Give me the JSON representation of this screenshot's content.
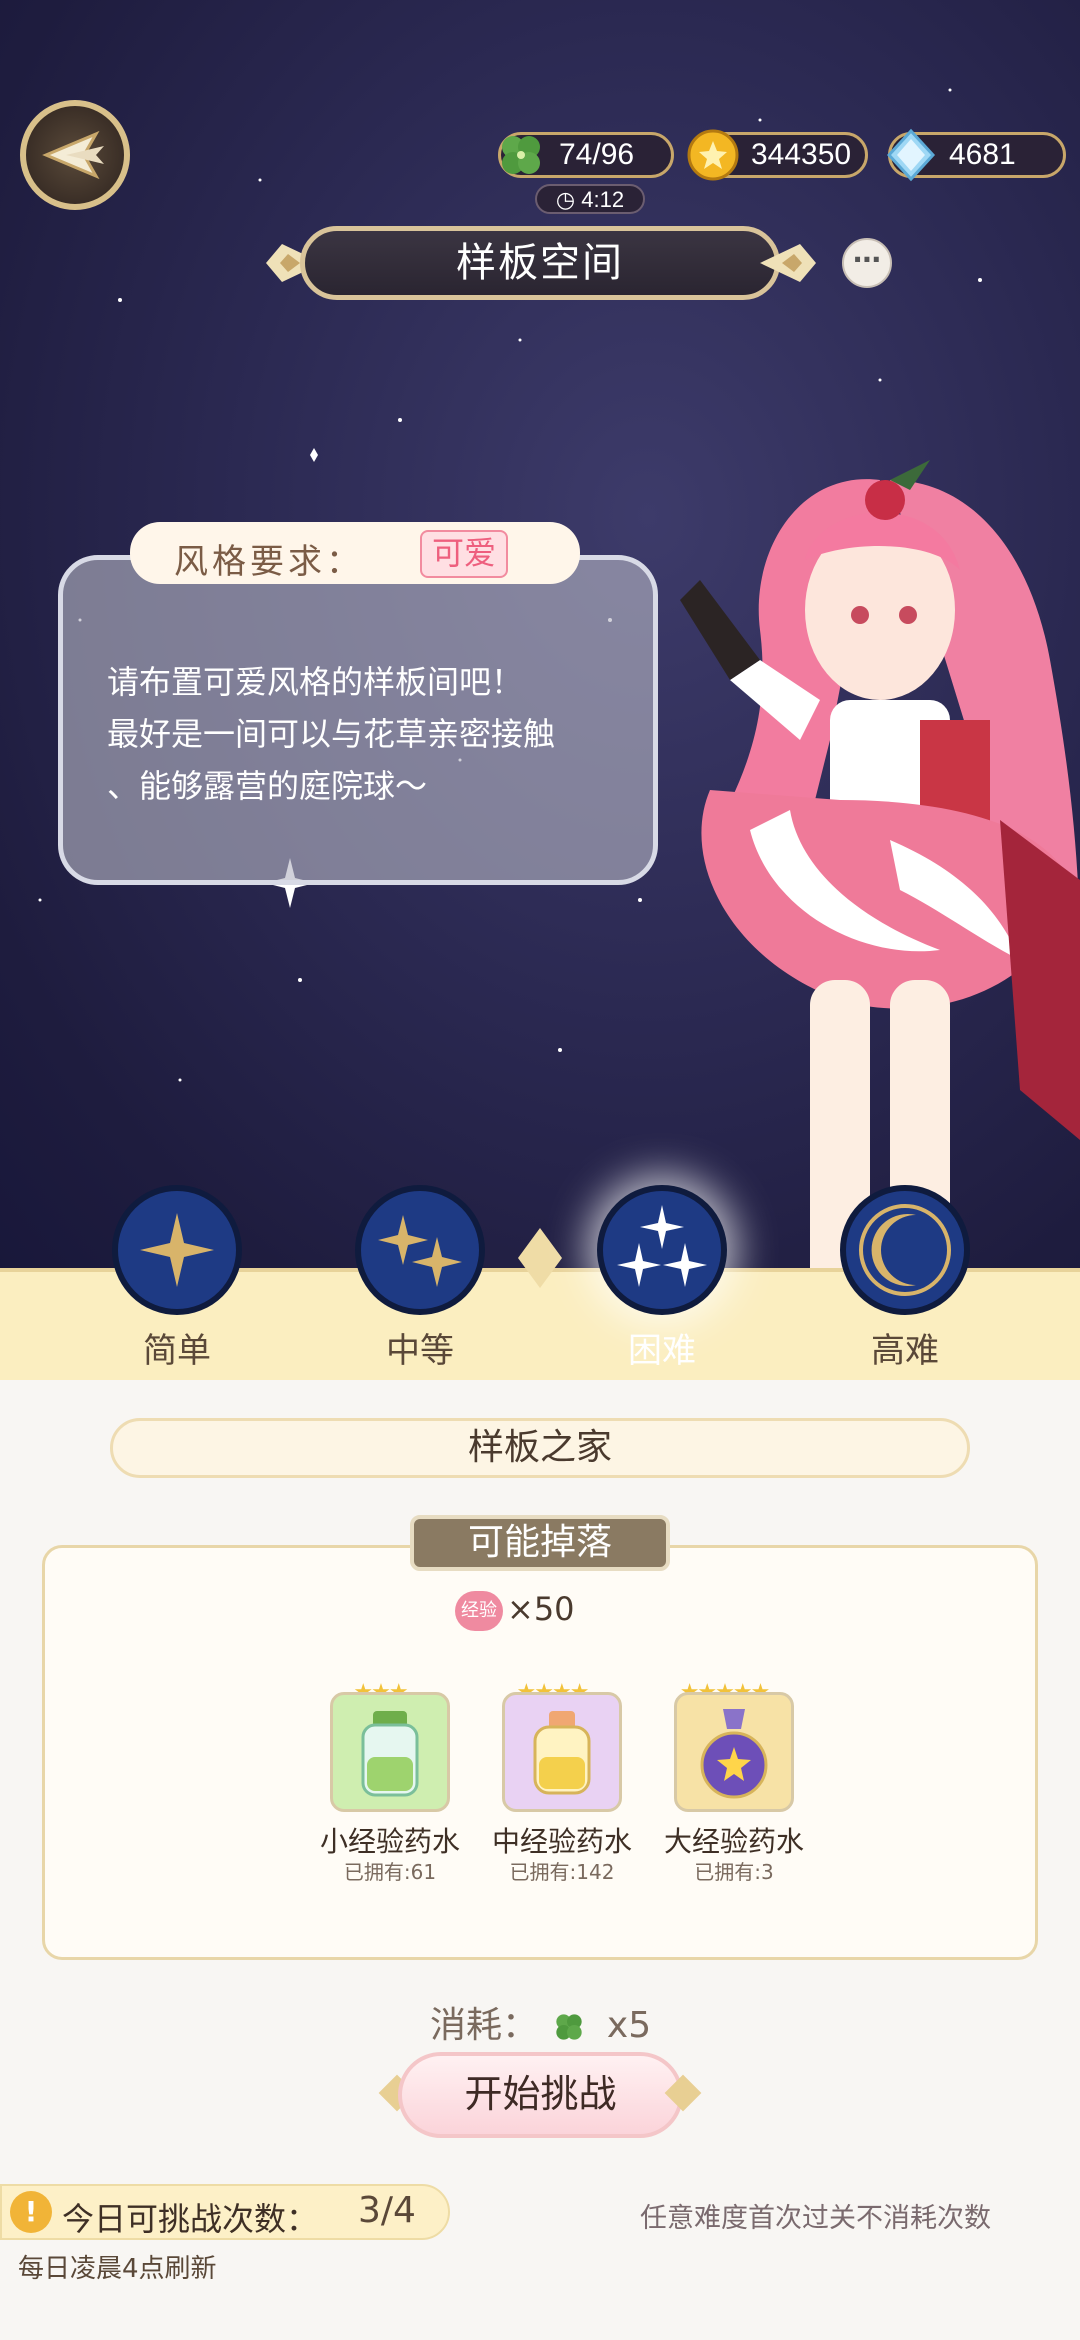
{
  "resources": {
    "clover": "74/96",
    "gold": "344350",
    "diamond": "4681",
    "timer": "4:12"
  },
  "title": "样板空间",
  "more_label": "⋯",
  "style_requirement": {
    "label": "风格要求：",
    "value": "可爱"
  },
  "bubble_text": "请布置可爱风格的样板间吧！\n最好是一间可以与花草亲密接触\n、能够露营的庭院球～",
  "difficulties": [
    {
      "label": "简单",
      "icon": "one-star-icon",
      "active": false
    },
    {
      "label": "中等",
      "icon": "two-star-icon",
      "active": false
    },
    {
      "label": "困难",
      "icon": "three-star-icon",
      "active": true
    },
    {
      "label": "高难",
      "icon": "moon-icon",
      "active": false
    }
  ],
  "stage_name": "样板之家",
  "drops": {
    "title": "可能掉落",
    "exp_badge": "经验",
    "exp_amount": "×50",
    "items": [
      {
        "name": "小经验药水",
        "owned": "已拥有:61",
        "stars": 3,
        "color": "#cfeeb0"
      },
      {
        "name": "中经验药水",
        "owned": "已拥有:142",
        "stars": 4,
        "color": "#e9d2f3"
      },
      {
        "name": "大经验药水",
        "owned": "已拥有:3",
        "stars": 5,
        "color": "#f7e2a6"
      }
    ]
  },
  "cost": {
    "label": "消耗：",
    "amount": "x5"
  },
  "start_button": "开始挑战",
  "daily": {
    "label": "今日可挑战次数：",
    "count": "3/4",
    "refresh": "每日凌晨4点刷新",
    "first_clear_note": "任意难度首次过关不消耗次数"
  },
  "colors": {
    "sky": "#2b2952",
    "accent_gold": "#d9c49a",
    "pink": "#ee5f7e",
    "band": "#fbeec0"
  }
}
